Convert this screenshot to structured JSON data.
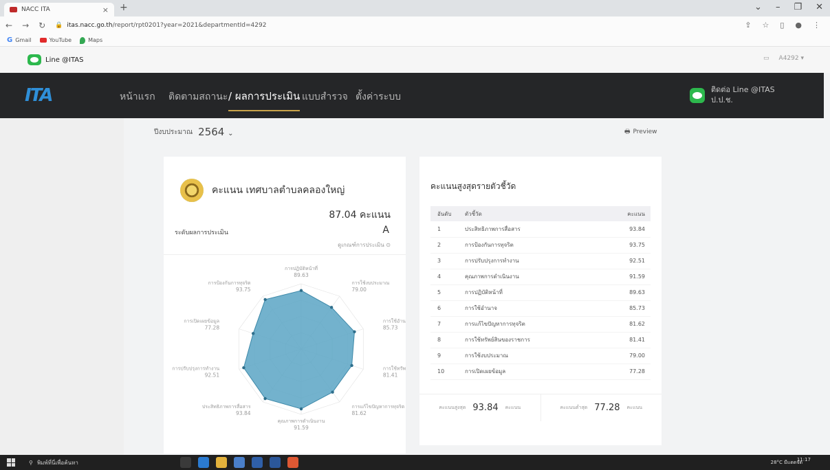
{
  "browser": {
    "tab_title": "NACC ITA",
    "url_host": "itas.nacc.go.th",
    "url_path": "/report/rpt0201?year=2021&departmentId=4292",
    "bookmarks": [
      "Gmail",
      "YouTube",
      "Maps"
    ]
  },
  "util": {
    "line_label": "Line @ITAS",
    "user": "A4292"
  },
  "nav": {
    "items": [
      "หน้าแรก",
      "ติดตามสถานะ",
      "/ ผลการประเมิน",
      "แบบสำรวจ",
      "ตั้งค่าระบบ"
    ],
    "line_title": "ติดต่อ Line @ITAS",
    "line_sub": "ป.ป.ช."
  },
  "toolbar": {
    "year_label": "ปีงบประมาณ",
    "year_value": "2564",
    "preview_label": "Preview"
  },
  "score_card": {
    "title": "คะแนน เทศบาลตำบลคลองใหญ่",
    "score": "87.04 คะแนน",
    "grade_label": "ระดับผลการประเมิน",
    "grade": "A",
    "criteria_link": "ดูเกณฑ์การประเมิน"
  },
  "chart_data": {
    "type": "radar",
    "categories": [
      "การปฏิบัติหน้าที่",
      "การใช้งบประมาณ",
      "การใช้อำนาจ",
      "การใช้ทรัพย์สินของราชการ",
      "การแก้ไขปัญหาการทุจริต",
      "คุณภาพการดำเนินงาน",
      "ประสิทธิภาพการสื่อสาร",
      "การปรับปรุงการทำงาน",
      "การเปิดเผยข้อมูล",
      "การป้องกันการทุจริต"
    ],
    "values": [
      89.63,
      79.0,
      85.73,
      81.41,
      81.62,
      91.59,
      93.84,
      92.51,
      77.28,
      93.75
    ],
    "value_labels": [
      "89.63",
      "79.00",
      "85.73",
      "81.41",
      "81.62",
      "91.59",
      "93.84",
      "92.51",
      "77.28",
      "93.75"
    ],
    "rlim": [
      0,
      100
    ],
    "color": "#5aa5c4"
  },
  "ranking": {
    "title": "คะแนนสูงสุดรายตัวชี้วัด",
    "headers": [
      "อันดับ",
      "ตัวชี้วัด",
      "คะแนน"
    ],
    "rows": [
      [
        "1",
        "ประสิทธิภาพการสื่อสาร",
        "93.84"
      ],
      [
        "2",
        "การป้องกันการทุจริต",
        "93.75"
      ],
      [
        "3",
        "การปรับปรุงการทำงาน",
        "92.51"
      ],
      [
        "4",
        "คุณภาพการดำเนินงาน",
        "91.59"
      ],
      [
        "5",
        "การปฏิบัติหน้าที่",
        "89.63"
      ],
      [
        "6",
        "การใช้อำนาจ",
        "85.73"
      ],
      [
        "7",
        "การแก้ไขปัญหาการทุจริต",
        "81.62"
      ],
      [
        "8",
        "การใช้ทรัพย์สินของราชการ",
        "81.41"
      ],
      [
        "9",
        "การใช้งบประมาณ",
        "79.00"
      ],
      [
        "10",
        "การเปิดเผยข้อมูล",
        "77.28"
      ]
    ],
    "max_label": "คะแนนสูงสุด",
    "max_value": "93.84",
    "min_label": "คะแนนต่ำสุด",
    "min_value": "77.28",
    "unit": "คะแนน"
  },
  "taskbar": {
    "search_placeholder": "พิมพ์ที่นี่เพื่อค้นหา",
    "weather": "28°C มีแดดจัด",
    "time": "11:17"
  }
}
